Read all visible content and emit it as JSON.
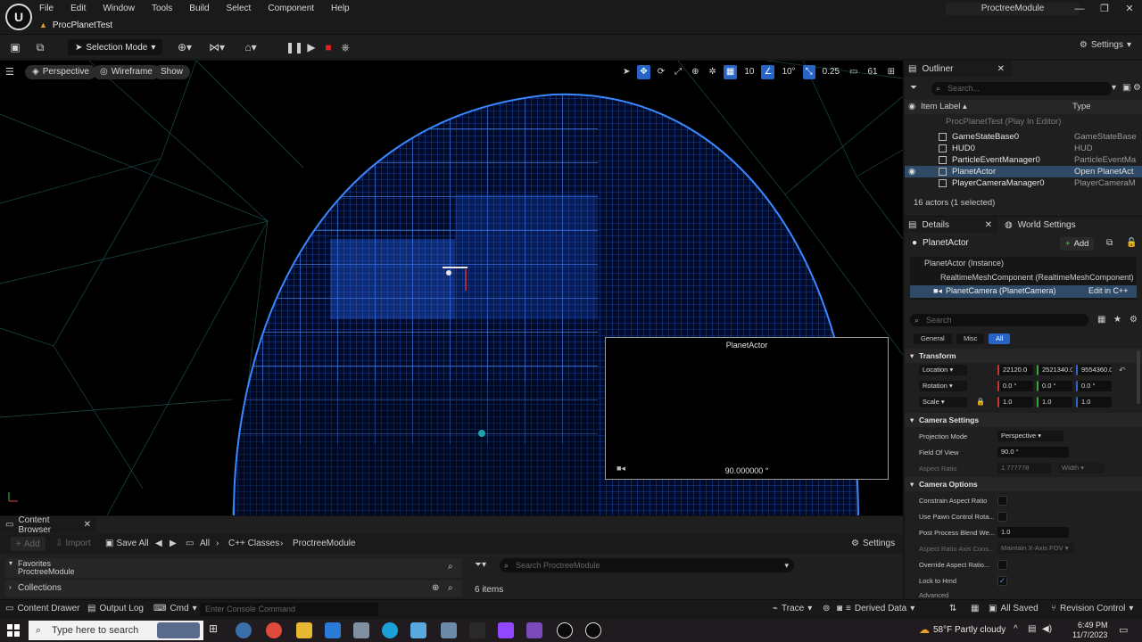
{
  "menu": [
    "File",
    "Edit",
    "Window",
    "Tools",
    "Build",
    "Select",
    "Component",
    "Help"
  ],
  "level_tab": "ProcPlanetTest",
  "project_name": "ProctreeModule",
  "toolbar": {
    "selection_mode": "Selection Mode",
    "settings": "Settings"
  },
  "viewport": {
    "perspective": "Perspective",
    "wireframe": "Wireframe",
    "show": "Show",
    "grid_snap": "10",
    "rot_snap": "10°",
    "scale_snap": "0.25",
    "cam_speed": "61"
  },
  "camera_preview": {
    "title": "PlanetActor",
    "fov": "90.000000 °"
  },
  "outliner": {
    "tab": "Outliner",
    "search_placeholder": "Search...",
    "col_label": "Item Label ▴",
    "col_type": "Type",
    "world_row": "ProcPlanetTest (Play In Editor)",
    "rows": [
      {
        "label": "GameStateBase0",
        "type": "GameStateBase"
      },
      {
        "label": "HUD0",
        "type": "HUD"
      },
      {
        "label": "ParticleEventManager0",
        "type": "ParticleEventMa"
      },
      {
        "label": "PlanetActor",
        "type": "Open PlanetAct"
      },
      {
        "label": "PlayerCameraManager0",
        "type": "PlayerCameraM"
      }
    ],
    "count": "16 actors (1 selected)"
  },
  "details": {
    "tab": "Details",
    "world_tab": "World Settings",
    "actor": "PlanetActor",
    "add": "Add",
    "instance": "PlanetActor (Instance)",
    "component": "RealtimeMeshComponent (RealtimeMeshComponent)",
    "camera": "PlanetCamera (PlanetCamera)",
    "edit_cpp": "Edit in C++",
    "search_placeholder": "Search",
    "filters": [
      "General",
      "Misc",
      "All"
    ],
    "transform": "Transform",
    "location_label": "Location",
    "rotation_label": "Rotation",
    "scale_label": "Scale",
    "location": [
      "22120.0",
      "2521340.0",
      "9554360.0"
    ],
    "rotation": [
      "0.0 °",
      "0.0 °",
      "0.0 °"
    ],
    "scale": [
      "1.0",
      "1.0",
      "1.0"
    ],
    "camera_settings": "Camera Settings",
    "projection_mode_label": "Projection Mode",
    "projection_mode": "Perspective",
    "fov_label": "Field Of View",
    "fov": "90.0 °",
    "aspect_label": "Aspect Ratio",
    "aspect": "1.777778",
    "aspect_unit": "Width",
    "camera_options": "Camera Options",
    "constrain_label": "Constrain Aspect Ratio",
    "pawn_label": "Use Pawn Control Rota...",
    "blend_label": "Post Process Blend We...",
    "blend": "1.0",
    "axis_label": "Aspect Ratio Axis Cons...",
    "axis": "Maintain X-Axis FOV",
    "override_label": "Override Aspect Ratio...",
    "lock_label": "Lock to Hmd",
    "advanced": "Advanced"
  },
  "content_browser": {
    "tab": "Content Browser",
    "add": "Add",
    "import": "Import",
    "save_all": "Save All",
    "crumbs": [
      "All",
      "C++ Classes",
      "ProctreeModule"
    ],
    "settings": "Settings",
    "favorites": "Favorites",
    "fav_item": "ProctreeModule",
    "collections": "Collections",
    "search_placeholder": "Search ProctreeModule",
    "items": "6 items"
  },
  "statusbar": {
    "drawer": "Content Drawer",
    "output": "Output Log",
    "cmd": "Cmd",
    "console_placeholder": "Enter Console Command",
    "trace": "Trace",
    "derived": "Derived Data",
    "saved": "All Saved",
    "revision": "Revision Control"
  },
  "taskbar": {
    "search": "Type here to search",
    "weather": "58°F  Partly cloudy",
    "time": "6:49 PM",
    "date": "11/7/2023"
  }
}
